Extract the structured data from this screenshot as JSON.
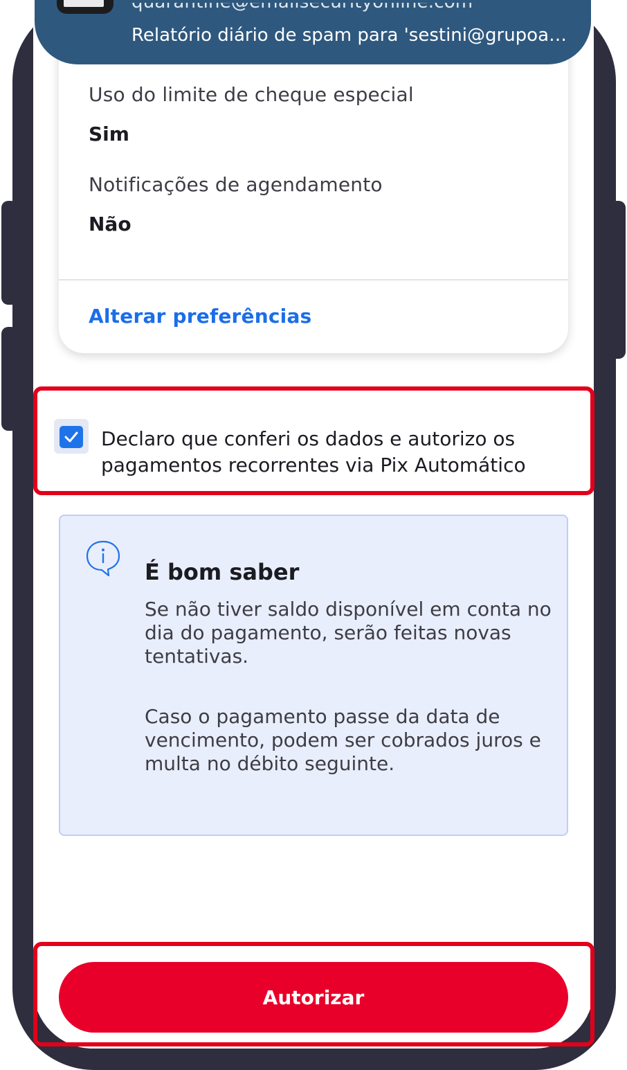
{
  "notification": {
    "sender": "quarantine@emailsecurityonline.com",
    "subject": "Relatório diário de spam para 'sestini@grupoamp...."
  },
  "preferences": {
    "fields": [
      {
        "label": "Uso do limite de cheque especial",
        "value": "Sim"
      },
      {
        "label": "Notificações de agendamento",
        "value": "Não"
      }
    ],
    "change_link": "Alterar preferências"
  },
  "consent": {
    "checked": true,
    "text": "Declaro que conferi os dados e autorizo os pagamentos recorrentes via Pix Automático"
  },
  "info_box": {
    "icon": "info-bubble-icon",
    "title": "É bom saber",
    "paragraphs": [
      "Se não tiver saldo disponível em conta no dia do pagamento, serão feitas novas tentativas.",
      "Caso o pagamento passe da data de vencimento, podem ser cobrados juros e multa no débito seguinte."
    ]
  },
  "action": {
    "label": "Autorizar"
  },
  "colors": {
    "brand_red": "#e8002a",
    "highlight_red": "#e2001a",
    "link_blue": "#1b6ee8",
    "checkbox_blue": "#1f73e8",
    "info_background": "#e9eefc",
    "phone_frame": "#2e2e3f",
    "banner_blue": "#2f587e"
  }
}
